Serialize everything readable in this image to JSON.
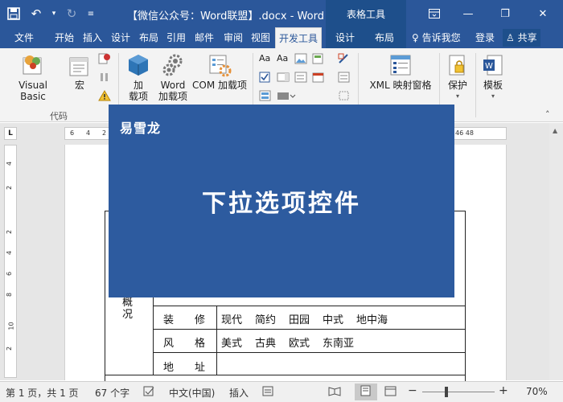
{
  "titlebar": {
    "title": "【微信公众号：Word联盟】.docx - Word",
    "context_header": "表格工具",
    "qat_save_icon": "save-icon",
    "min_glyph": "—",
    "restore_glyph": "❐",
    "close_glyph": "✕"
  },
  "tabs": {
    "file": "文件",
    "home": "开始",
    "insert": "插入",
    "design": "设计",
    "layout": "布局",
    "references": "引用",
    "mailings": "邮件",
    "review": "审阅",
    "view": "视图",
    "developer": "开发工具",
    "table_design": "设计",
    "table_layout": "布局",
    "tellme": "告诉我您",
    "signin": "登录",
    "share": "共享"
  },
  "ribbon": {
    "visual_basic": "Visual Basic",
    "macros": "宏",
    "group_code": "代码",
    "addins_line1": "加",
    "addins_line2": "载项",
    "word_addins_line1": "Word",
    "word_addins_line2": "加载项",
    "com_addins": "COM 加载项",
    "aa_label": "Aa",
    "xml_mapping": "XML 映射窗格",
    "protect": "保护",
    "template": "模板"
  },
  "ruler": {
    "ticks_left": [
      "6",
      "4",
      "2"
    ],
    "ticks_right": "46 48",
    "vticks": [
      "4",
      "2",
      "2",
      "4",
      "6",
      "8",
      "10",
      "2"
    ]
  },
  "banner": {
    "brand": "易雪龙",
    "title": "下拉选项控件"
  },
  "table": {
    "side_label_1": "概",
    "side_label_2": "况",
    "row_decor_label": "装　　修",
    "row_decor_options": [
      "现代",
      "简约",
      "田园",
      "中式",
      "地中海"
    ],
    "row_style_label": "风　　格",
    "row_style_options": [
      "美式",
      "古典",
      "欧式",
      "东南亚"
    ],
    "row_address_label": "地　　址"
  },
  "statusbar": {
    "page": "第 1 页，共 1 页",
    "words": "67 个字",
    "language": "中文(中国)",
    "mode": "插入",
    "zoom": "70%",
    "zoom_level": 70
  }
}
